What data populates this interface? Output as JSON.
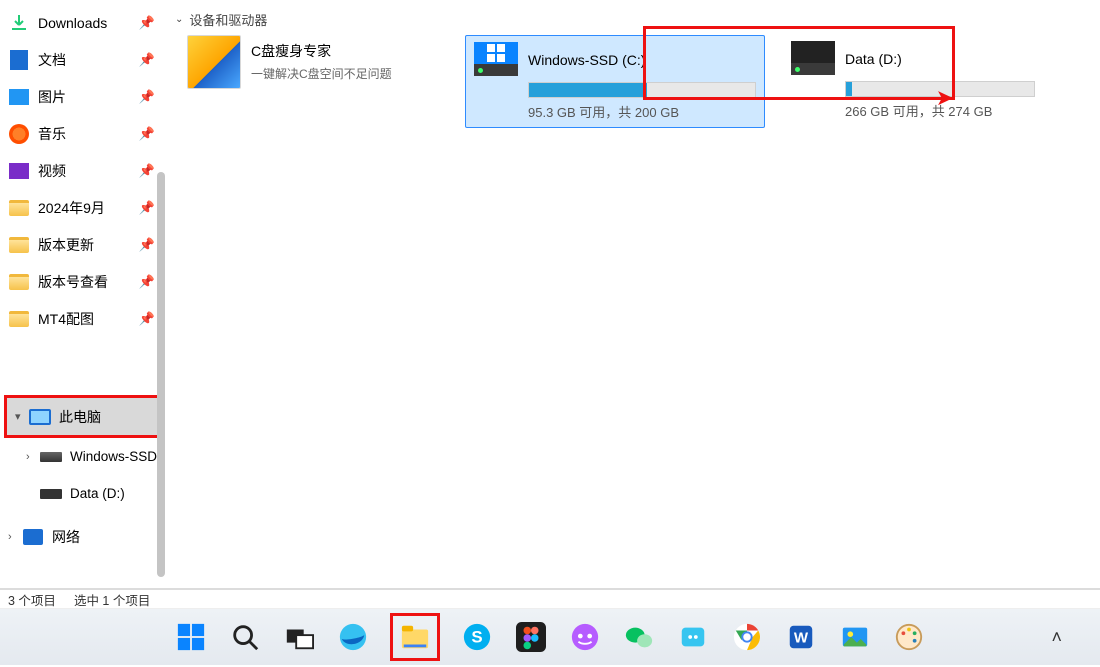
{
  "sidebar": {
    "pinned": [
      {
        "icon": "download",
        "label": "Downloads"
      },
      {
        "icon": "doc",
        "label": "文档"
      },
      {
        "icon": "img",
        "label": "图片"
      },
      {
        "icon": "music",
        "label": "音乐"
      },
      {
        "icon": "vid",
        "label": "视频"
      },
      {
        "icon": "folder",
        "label": "2024年9月"
      },
      {
        "icon": "folder",
        "label": "版本更新"
      },
      {
        "icon": "folder",
        "label": "版本号查看"
      },
      {
        "icon": "folder",
        "label": "MT4配图"
      }
    ],
    "this_pc": {
      "label": "此电脑"
    },
    "drives": [
      {
        "label": "Windows-SSD"
      },
      {
        "label": "Data (D:)"
      }
    ],
    "network": {
      "label": "网络"
    }
  },
  "section_header": "设备和驱动器",
  "tool": {
    "title": "C盘瘦身专家",
    "subtitle": "一键解决C盘空间不足问题"
  },
  "drive_c": {
    "name": "Windows-SSD (C:)",
    "free": "95.3 GB 可用，共 200 GB",
    "used_pct": 52
  },
  "drive_d": {
    "name": "Data (D:)",
    "free": "266 GB 可用，共 274 GB",
    "used_pct": 3
  },
  "status": {
    "count": "3 个项目",
    "sel": "选中 1 个项目"
  },
  "taskbar": {
    "items": [
      "start",
      "search",
      "taskview",
      "edge",
      "explorer",
      "skype",
      "figma",
      "discord",
      "wechat",
      "fox",
      "chrome",
      "word",
      "photos",
      "paint"
    ]
  }
}
